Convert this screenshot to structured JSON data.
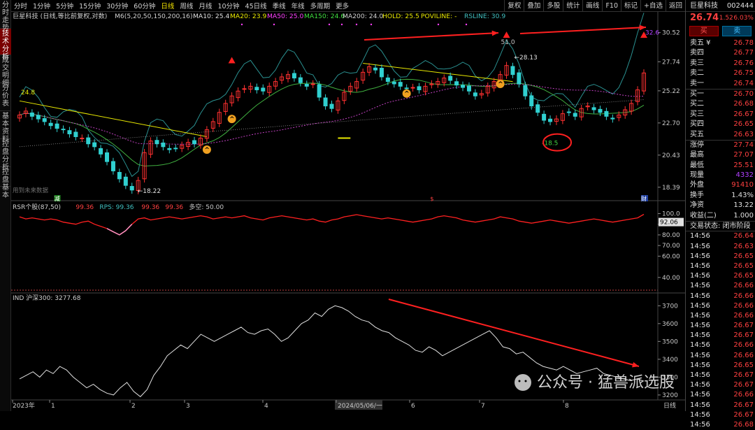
{
  "left_tabs": [
    "分时走势",
    "技术分析",
    "成交明细",
    "分价表",
    "基本资料",
    "控盘分析",
    "控盘基本"
  ],
  "toolbar": {
    "items": [
      "分时",
      "1分钟",
      "5分钟",
      "15分钟",
      "30分钟",
      "60分钟",
      "日线",
      "周线",
      "月线",
      "10分钟",
      "45日线",
      "季线",
      "年线",
      "多周期",
      "更多"
    ],
    "active": "日线",
    "right": [
      "复权",
      "叠加",
      "多股",
      "统计",
      "画线",
      "F10",
      "标记",
      "+自选",
      "返回"
    ]
  },
  "price_legend": {
    "title": "巨星科技 (日线,等比前复权,对数)",
    "m6": "M6(5,20,50,150,200,16)",
    "ma10": "MA10: 25.4",
    "ma20": "MA20: 23.9",
    "ma50": "MA50: 25.0",
    "ma150": "MA150: 24.6",
    "ma200": "MA200: 24.0",
    "hold": "HOLD: 25.5",
    "poviline": "POVILINE: -",
    "rsline": "RSLINE: 30.9"
  },
  "price_axis": [
    "30.52",
    "27.74",
    "25.22",
    "22.70",
    "20.43",
    "18.39"
  ],
  "annotations": {
    "p1": "24.8",
    "p2": "18.22",
    "p3": "51.0",
    "p4": "28.13",
    "p5": "-18.5",
    "p6": "32.6",
    "future": "用到未来数据",
    "tag1": "减",
    "tag2": "$",
    "tag3": "财"
  },
  "rsr_legend": {
    "title": "RSR个股(87,50)",
    "v1": "99.36",
    "rps": "RPS: 99.36",
    "v2": "99.36",
    "v3": "99.36",
    "dk": "多空: 50.00"
  },
  "rsr_axis": [
    "100.0",
    "90.00",
    "80.00",
    "70.00",
    "60.00",
    "40.00"
  ],
  "rsr_value": "92.06",
  "ind_legend": {
    "title": "IND 沪深300: 3277.68"
  },
  "ind_axis": [
    "3700",
    "3600",
    "3500",
    "3400",
    "3300",
    "3200"
  ],
  "date_axis": [
    "2023年",
    "1",
    "2",
    "3",
    "4",
    "2024/05/06/一",
    "6",
    "7",
    "8"
  ],
  "date_axis_right": "日线",
  "watermark": "公众号 · 猛兽派选股",
  "stock": {
    "name": "巨星科技",
    "code": "002444",
    "price": "26.74",
    "change": "1.52",
    "pct": "6.03%",
    "buy_btn": "买",
    "sell_btn": "卖"
  },
  "orderbook": {
    "asks": [
      {
        "label": "卖五",
        "price": "26.78",
        "sym": "¥"
      },
      {
        "label": "卖四",
        "price": "26.77"
      },
      {
        "label": "卖三",
        "price": "26.76"
      },
      {
        "label": "卖二",
        "price": "26.75"
      },
      {
        "label": "卖一",
        "price": "26.74"
      }
    ],
    "bids": [
      {
        "label": "买一",
        "price": "26.70"
      },
      {
        "label": "买二",
        "price": "26.68"
      },
      {
        "label": "买三",
        "price": "26.67"
      },
      {
        "label": "买四",
        "price": "26.65"
      },
      {
        "label": "买五",
        "price": "26.63"
      }
    ]
  },
  "stats": [
    {
      "label": "涨停",
      "value": "27.74"
    },
    {
      "label": "最高",
      "value": "27.07"
    },
    {
      "label": "最低",
      "value": "25.51"
    },
    {
      "label": "现量",
      "value": "4332"
    },
    {
      "label": "外盘",
      "value": "91410"
    },
    {
      "label": "换手",
      "value": "1.43%"
    },
    {
      "label": "净资",
      "value": "13.22"
    },
    {
      "label": "收益(二)",
      "value": "1.000"
    }
  ],
  "trade_state": "交易状态: 闭市阶段",
  "ticks": [
    [
      "14:56",
      "26.64"
    ],
    [
      "14:56",
      "26.63"
    ],
    [
      "14:56",
      "26.65"
    ],
    [
      "14:56",
      "26.65"
    ],
    [
      "14:56",
      "26.65"
    ],
    [
      "14:56",
      "26.66"
    ],
    [
      "14:56",
      "26.66"
    ],
    [
      "14:56",
      "26.66"
    ],
    [
      "14:56",
      "26.66"
    ],
    [
      "14:56",
      "26.67"
    ],
    [
      "14:56",
      "26.67"
    ],
    [
      "14:56",
      "26.66"
    ],
    [
      "14:56",
      "26.66"
    ],
    [
      "14:56",
      "26.65"
    ],
    [
      "14:56",
      "26.67"
    ],
    [
      "14:56",
      "26.67"
    ],
    [
      "14:56",
      "26.66"
    ],
    [
      "14:56",
      "26.67"
    ],
    [
      "14:56",
      "26.67"
    ],
    [
      "14:56",
      "26.68"
    ]
  ],
  "chart_data": {
    "type": "line",
    "price_closes": [
      23.3,
      23.6,
      23.2,
      23.0,
      22.8,
      22.5,
      22.3,
      22.2,
      21.9,
      21.7,
      21.6,
      21.2,
      21.0,
      20.5,
      20.0,
      19.4,
      18.9,
      18.5,
      18.22,
      18.8,
      20.6,
      21.4,
      21.2,
      21.0,
      20.8,
      20.9,
      21.1,
      21.3,
      21.2,
      21.6,
      22.2,
      22.8,
      23.5,
      24.2,
      24.8,
      25.2,
      25.4,
      25.6,
      25.3,
      25.2,
      25.6,
      26.0,
      26.4,
      26.6,
      26.3,
      25.9,
      25.6,
      25.8,
      24.7,
      24.0,
      23.8,
      24.4,
      25.1,
      25.6,
      26.0,
      26.8,
      27.3,
      27.0,
      26.4,
      26.0,
      25.8,
      25.6,
      25.4,
      25.5,
      25.3,
      25.6,
      25.8,
      26.0,
      26.3,
      26.1,
      25.7,
      25.5,
      25.2,
      24.8,
      25.0,
      25.6,
      26.0,
      26.6,
      27.4,
      26.6,
      25.8,
      24.8,
      24.0,
      23.5,
      22.9,
      22.8,
      23.0,
      23.4,
      23.5,
      23.2,
      23.8,
      24.0,
      23.7,
      23.5,
      23.2,
      23.0,
      23.3,
      23.7,
      24.2,
      25.3,
      26.74
    ],
    "rsr": [
      97,
      95,
      96,
      95,
      94,
      95,
      94,
      92,
      91,
      90,
      92,
      93,
      90,
      88,
      86,
      83,
      80,
      84,
      90,
      95,
      96,
      94,
      95,
      96,
      97,
      96,
      95,
      96,
      97,
      98,
      97,
      95,
      96,
      97,
      96,
      97,
      98,
      96,
      95,
      94,
      96,
      97,
      98,
      97,
      96,
      95,
      94,
      95,
      93,
      92,
      94,
      95,
      97,
      98,
      99,
      98,
      97,
      96,
      95,
      96,
      95,
      94,
      93,
      92,
      93,
      94,
      95,
      97,
      98,
      97,
      96,
      94,
      93,
      92,
      93,
      94,
      95,
      97,
      96,
      95,
      93,
      92,
      91,
      92,
      93,
      94,
      93,
      92,
      91,
      92,
      93,
      94,
      95,
      94,
      93,
      92,
      93,
      94,
      95,
      96,
      99.36
    ],
    "ind": [
      3290,
      3310,
      3330,
      3300,
      3340,
      3320,
      3360,
      3340,
      3300,
      3270,
      3240,
      3260,
      3230,
      3210,
      3200,
      3240,
      3270,
      3220,
      3190,
      3230,
      3310,
      3360,
      3420,
      3450,
      3480,
      3460,
      3500,
      3540,
      3520,
      3500,
      3520,
      3540,
      3560,
      3580,
      3550,
      3540,
      3560,
      3570,
      3540,
      3500,
      3520,
      3560,
      3600,
      3620,
      3660,
      3640,
      3680,
      3700,
      3690,
      3670,
      3640,
      3620,
      3610,
      3580,
      3560,
      3550,
      3520,
      3500,
      3480,
      3450,
      3440,
      3470,
      3450,
      3420,
      3440,
      3460,
      3480,
      3500,
      3520,
      3540,
      3560,
      3520,
      3470,
      3460,
      3430,
      3440,
      3410,
      3380,
      3360,
      3350,
      3340,
      3360,
      3340,
      3320,
      3330,
      3340,
      3350,
      3320,
      3310,
      3300,
      3290,
      3280,
      3290,
      3277.68
    ]
  }
}
